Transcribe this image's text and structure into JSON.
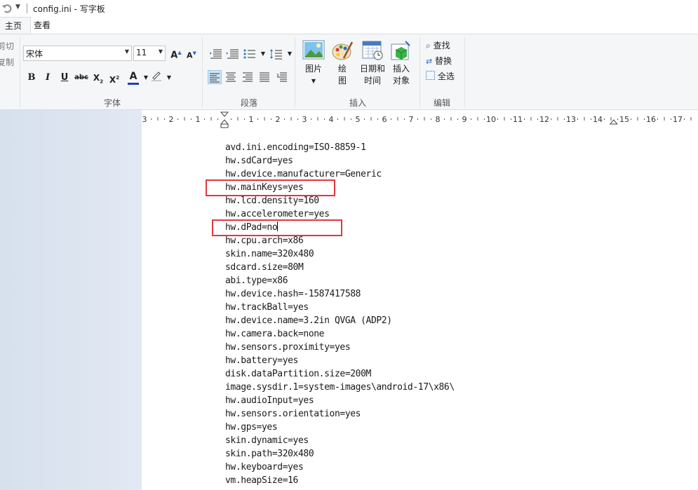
{
  "window": {
    "title": "config.ini - 写字板"
  },
  "tabs": [
    {
      "label": "主页",
      "active": true
    },
    {
      "label": "查看",
      "active": false
    }
  ],
  "ribbon": {
    "clipboard": {
      "items": [
        "剪切",
        "复制"
      ]
    },
    "font": {
      "group_label": "字体",
      "font_name": "宋体",
      "font_size": "11",
      "grow_label": "A",
      "shrink_label": "A",
      "bold_label": "B",
      "italic_label": "I",
      "underline_label": "U",
      "strike_label": "abc",
      "sub_label": "X",
      "sup_label": "X",
      "color_label": "A",
      "font_color": "#1f3fb8",
      "highlight_color": "#ffff00"
    },
    "paragraph": {
      "group_label": "段落"
    },
    "insert": {
      "group_label": "插入",
      "picture_label": "图片",
      "paint_label_1": "绘",
      "paint_label_2": "图",
      "datetime_label_1": "日期和",
      "datetime_label_2": "时间",
      "object_label_1": "插入",
      "object_label_2": "对象"
    },
    "editing": {
      "group_label": "编辑",
      "find_label": "查找",
      "replace_label": "替换",
      "select_all_label": "全选"
    }
  },
  "ruler": {
    "labels": [
      "3",
      "2",
      "1",
      "1",
      "2",
      "3",
      "4",
      "5",
      "6",
      "7",
      "8",
      "9",
      "10",
      "11",
      "12",
      "13",
      "14",
      "15",
      "16",
      "17"
    ]
  },
  "document": {
    "lines": [
      "avd.ini.encoding=ISO-8859-1",
      "hw.sdCard=yes",
      "hw.device.manufacturer=Generic",
      "hw.mainKeys=yes",
      "hw.lcd.density=160",
      "hw.accelerometer=yes",
      "hw.dPad=no",
      "hw.cpu.arch=x86",
      "skin.name=320x480",
      "sdcard.size=80M",
      "abi.type=x86",
      "hw.device.hash=-1587417588",
      "hw.trackBall=yes",
      "hw.device.name=3.2in QVGA (ADP2)",
      "hw.camera.back=none",
      "hw.sensors.proximity=yes",
      "hw.battery=yes",
      "disk.dataPartition.size=200M",
      "image.sysdir.1=system-images\\android-17\\x86\\",
      "hw.audioInput=yes",
      "hw.sensors.orientation=yes",
      "hw.gps=yes",
      "skin.dynamic=yes",
      "skin.path=320x480",
      "hw.keyboard=yes",
      "vm.heapSize=16"
    ],
    "highlighted_lines": [
      "hw.mainKeys=yes",
      "hw.dPad=no"
    ],
    "highlight_color": "#e0383d"
  }
}
